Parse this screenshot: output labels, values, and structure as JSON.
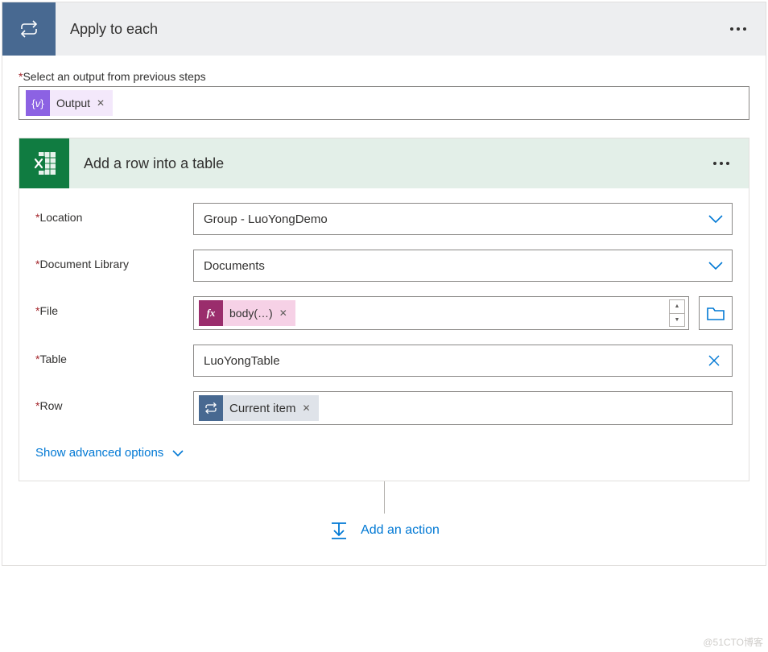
{
  "outer": {
    "title": "Apply to each",
    "select_output_label": "Select an output from previous steps",
    "output_token": "Output"
  },
  "inner": {
    "title": "Add a row into a table",
    "fields": {
      "location": {
        "label": "Location",
        "value": "Group - LuoYongDemo"
      },
      "doclib": {
        "label": "Document Library",
        "value": "Documents"
      },
      "file": {
        "label": "File",
        "token": "body(…)"
      },
      "table": {
        "label": "Table",
        "value": "LuoYongTable"
      },
      "row": {
        "label": "Row",
        "token": "Current item"
      }
    },
    "advanced": "Show advanced options"
  },
  "add_action": "Add an action",
  "watermark": "@51CTO博客"
}
